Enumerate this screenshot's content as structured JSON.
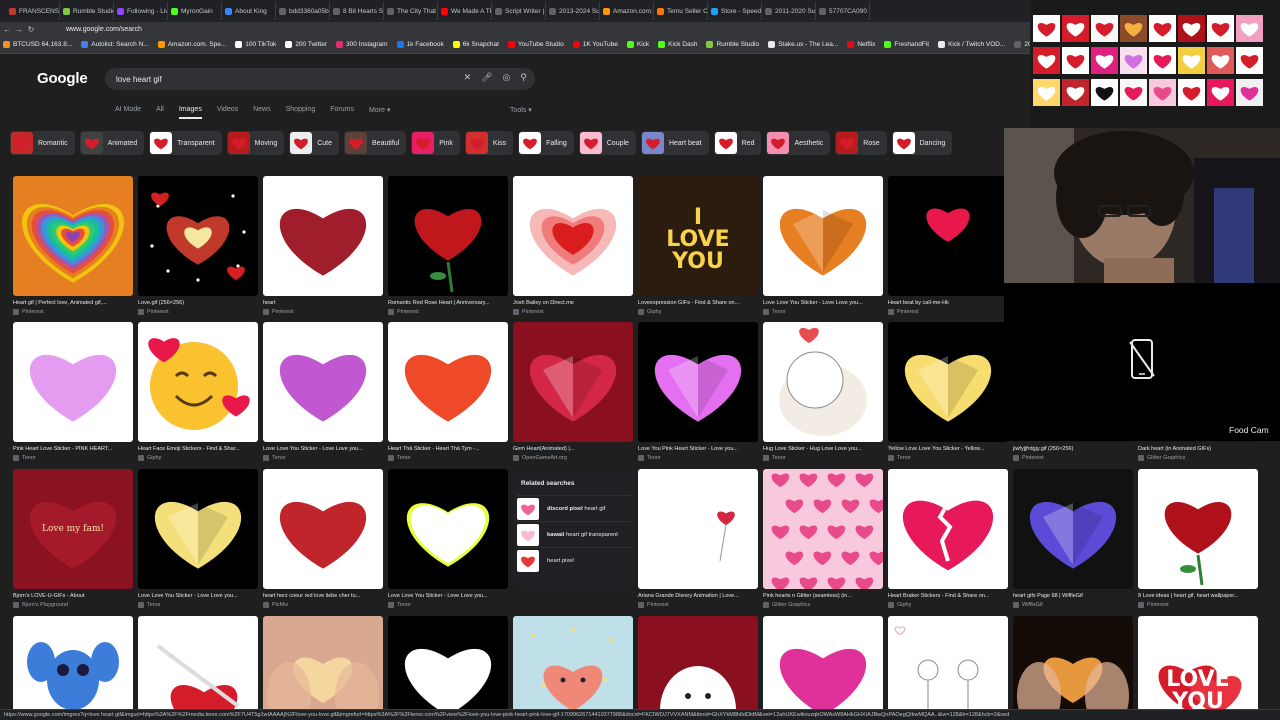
{
  "browser": {
    "tabs": [
      {
        "label": "FRANSCENSIO",
        "color": "#c0392b"
      },
      {
        "label": "Rumble Studio",
        "color": "#85c742"
      },
      {
        "label": "Following - Liv",
        "color": "#9146ff"
      },
      {
        "label": "MyronGain",
        "color": "#53fc18"
      },
      {
        "label": "About King",
        "color": "#3b82f6"
      },
      {
        "label": "bdd3360a05b",
        "color": "#5f6368"
      },
      {
        "label": "8 Bit Hearts St",
        "color": "#5f6368"
      },
      {
        "label": "The City That I",
        "color": "#5f6368"
      },
      {
        "label": "We Made A TF",
        "color": "#ff0000"
      },
      {
        "label": "Script Writer |",
        "color": "#5f6368"
      },
      {
        "label": "2013-2024 Su",
        "color": "#5f6368"
      },
      {
        "label": "Amazon.com: A",
        "color": "#ff9900"
      },
      {
        "label": "Temu Seller C",
        "color": "#fb7701"
      },
      {
        "label": "Store - Speedi",
        "color": "#1da1f2"
      },
      {
        "label": "2011-2020 Su",
        "color": "#5f6368"
      },
      {
        "label": "57707CA090",
        "color": "#5f6368"
      }
    ],
    "url": "www.google.com/search",
    "bookmarks": [
      {
        "label": "BTCUSD 64,163.8...",
        "color": "#f7931a"
      },
      {
        "label": "Autolist: Search N...",
        "color": "#3b82f6"
      },
      {
        "label": "Amazon.com. Spe...",
        "color": "#ff9900"
      },
      {
        "label": "100 TikTok",
        "color": "#ffffff"
      },
      {
        "label": "200 Twitter",
        "color": "#ffffff"
      },
      {
        "label": "300 Instagram",
        "color": "#e1306c"
      },
      {
        "label": "1k Facebook",
        "color": "#1877f2"
      },
      {
        "label": "6k Snapchat",
        "color": "#fffc00"
      },
      {
        "label": "YouTube Studio",
        "color": "#ff0000"
      },
      {
        "label": "1K YouTube",
        "color": "#ff0000"
      },
      {
        "label": "Kick",
        "color": "#53fc18"
      },
      {
        "label": "Kick Dash",
        "color": "#53fc18"
      },
      {
        "label": "Rumble Studio",
        "color": "#85c742"
      },
      {
        "label": "Stake.us - The Lea...",
        "color": "#e8eaed"
      },
      {
        "label": "Netflix",
        "color": "#e50914"
      },
      {
        "label": "FreshandFit",
        "color": "#53fc18"
      },
      {
        "label": "Kick / Twitch VOD...",
        "color": "#e8eaed"
      },
      {
        "label": "2013-",
        "color": "#5f6368"
      }
    ]
  },
  "google": {
    "logo": "Google",
    "query": "love heart gif",
    "tabs": [
      "AI Mode",
      "All",
      "Images",
      "Videos",
      "News",
      "Shopping",
      "Forums",
      "More ▾"
    ],
    "active_tab": "Images",
    "tools": "Tools ▾",
    "chips": [
      {
        "label": "Romantic",
        "color": "#c62828"
      },
      {
        "label": "Animated",
        "color": "#424242"
      },
      {
        "label": "Transparent",
        "color": "#ffffff"
      },
      {
        "label": "Moving",
        "color": "#b71c1c"
      },
      {
        "label": "Cute",
        "color": "#eeeeee"
      },
      {
        "label": "Beautiful",
        "color": "#5d4037"
      },
      {
        "label": "Pink",
        "color": "#e91e63"
      },
      {
        "label": "Kiss",
        "color": "#d32f2f"
      },
      {
        "label": "Falling",
        "color": "#ffffff"
      },
      {
        "label": "Couple",
        "color": "#f8bbd0"
      },
      {
        "label": "Heart beat",
        "color": "#7986cb"
      },
      {
        "label": "Red",
        "color": "#ffffff"
      },
      {
        "label": "Aesthetic",
        "color": "#f48fb1"
      },
      {
        "label": "Rose",
        "color": "#b71c1c"
      },
      {
        "label": "Dancing",
        "color": "#ffffff"
      }
    ],
    "results": [
      {
        "caption": "Heart gif | Perfect love, Animated gif,...",
        "source": "Pinterest",
        "bg": "#e67e22",
        "heart": "#9b59b6",
        "style": "rainbow"
      },
      {
        "caption": "Love.gif (256×256)",
        "source": "Pinterest",
        "bg": "#000000",
        "heart": "#c0392b",
        "style": "sparkle"
      },
      {
        "caption": "heart",
        "source": "Pinterest",
        "bg": "#ffffff",
        "heart": "#a01d2b",
        "style": "glitter"
      },
      {
        "caption": "Romantic Red Rose Heart | Anniversary...",
        "source": "Pinterest",
        "bg": "#000000",
        "heart": "#c0171c",
        "style": "rose"
      },
      {
        "caption": "Josh Bailey on Direct.me",
        "source": "Pinterest",
        "bg": "#ffffff",
        "heart": "#e84c4c",
        "style": "layered"
      },
      {
        "caption": "Loveexpression GIFs - Find & Share on...",
        "source": "Giphy",
        "bg": "#2b1c0e",
        "heart": "#f1c40f",
        "style": "iloveyou"
      },
      {
        "caption": "Love Love You Sticker - Love Love you...",
        "source": "Tenor",
        "bg": "#ffffff",
        "heart": "#e67e22",
        "style": "gem"
      },
      {
        "caption": "Heart beat by call-me-Hk",
        "source": "Pinterest",
        "bg": "#000000",
        "heart": "#e8194a",
        "style": "pixelsmall"
      },
      {
        "caption": "Pink Heart Love Sticker - PINK HEART...",
        "source": "Tenor",
        "bg": "#ffffff",
        "heart": "#e49cf0",
        "style": "pixel"
      },
      {
        "caption": "Heart Face Emoji Stickers - Find & Shar...",
        "source": "Giphy",
        "bg": "#ffffff",
        "heart": "#f9c22e",
        "style": "emoji"
      },
      {
        "caption": "Love Love You Sticker - Love Love you...",
        "source": "Tenor",
        "bg": "#ffffff",
        "heart": "#c158d1",
        "style": "pixel"
      },
      {
        "caption": "Heart Thả Sticker - Heart Thả Tym -...",
        "source": "Tenor",
        "bg": "#ffffff",
        "heart": "#ee4a2a",
        "style": "plain"
      },
      {
        "caption": "Gem Heart(Animated) |...",
        "source": "OpenGameArt.org",
        "bg": "#8a0f1f",
        "heart": "#d42745",
        "style": "gem"
      },
      {
        "caption": "Love You Pink Heart Sticker - Love you...",
        "source": "Tenor",
        "bg": "#000000",
        "heart": "#e46ff0",
        "style": "gem"
      },
      {
        "caption": "Hug Love Sticker - Hug Love Love you...",
        "source": "Tenor",
        "bg": "#ffffff",
        "heart": "#ffffff",
        "style": "bear"
      },
      {
        "caption": "Yellow Love Love You Sticker - Yellow...",
        "source": "Tenor",
        "bg": "#000000",
        "heart": "#f7dc6f",
        "style": "gem"
      },
      {
        "caption": "jiwfyjjfrdgjy.gif (256×256)",
        "source": "Pinterest",
        "bg": "#1a1a1a",
        "heart": "#1a1a1a",
        "style": "none"
      },
      {
        "caption": "Dark heart (in Animated GIFs)",
        "source": "Glitter Graphics",
        "bg": "#1a1a1a",
        "heart": "#1a1a1a",
        "style": "none"
      },
      {
        "caption": "Bjorn's LOVE-U-GIFs - About",
        "source": "Bjorn's Playground",
        "bg": "#8b1221",
        "heart": "#a41a2b",
        "style": "lovemyfam"
      },
      {
        "caption": "Love Love You Sticker - Love Love you...",
        "source": "Tenor",
        "bg": "#000000",
        "heart": "#f4e07a",
        "style": "gem"
      },
      {
        "caption": "heart herz coeur red love liebe cher tu...",
        "source": "PicMix",
        "bg": "#ffffff",
        "heart": "#c0252b",
        "style": "plain"
      },
      {
        "caption": "Love Love You Sticker - Love Love you...",
        "source": "Tenor",
        "bg": "#000000",
        "heart": "#ffffff",
        "style": "neon"
      },
      {
        "caption": "Ariana Grande Disney Animation | Love...",
        "source": "Pinterest",
        "bg": "#ffffff",
        "heart": "#d42745",
        "style": "balloon"
      },
      {
        "caption": "Pink hearts n Glitter (seamless) (in...",
        "source": "Glitter Graphics",
        "bg": "#f8c8dc",
        "heart": "#e84b8a",
        "style": "pattern"
      },
      {
        "caption": "Heart Braker Stickers - Find & Share on...",
        "source": "Giphy",
        "bg": "#ffffff",
        "heart": "#e8195a",
        "style": "broken"
      },
      {
        "caption": "heart gifs Page 98 | WiffleGif",
        "source": "WiffleGif",
        "bg": "#111111",
        "heart": "#5b4bd6",
        "style": "gem"
      },
      {
        "caption": "8 Love ideas | heart gif, heart wallpaper...",
        "source": "Pinterest",
        "bg": "#ffffff",
        "heart": "#b0121b",
        "style": "rose"
      },
      {
        "caption": "",
        "source": "",
        "bg": "#ffffff",
        "heart": "#3b82f6",
        "style": "stitch"
      },
      {
        "caption": "",
        "source": "",
        "bg": "#ffffff",
        "heart": "#d41c2b",
        "style": "arrow"
      },
      {
        "caption": "",
        "source": "",
        "bg": "#d9a890",
        "heart": "#f8d8a0",
        "style": "hands"
      },
      {
        "caption": "",
        "source": "",
        "bg": "#000000",
        "heart": "#ffffff",
        "style": "plain"
      },
      {
        "caption": "",
        "source": "",
        "bg": "#bfe0e8",
        "heart": "#f08878",
        "style": "cute"
      },
      {
        "caption": "",
        "source": "",
        "bg": "#8a0f1f",
        "heart": "#ffffff",
        "style": "ghost"
      },
      {
        "caption": "",
        "source": "",
        "bg": "#ffffff",
        "heart": "#e0309a",
        "style": "glitter"
      },
      {
        "caption": "",
        "source": "",
        "bg": "#ffffff",
        "heart": "#888888",
        "style": "sketch"
      },
      {
        "caption": "",
        "source": "",
        "bg": "#150c08",
        "heart": "#f0a040",
        "style": "hands"
      },
      {
        "caption": "",
        "source": "",
        "bg": "#ffffff",
        "heart": "#d41c2b",
        "style": "iloveyou2"
      }
    ],
    "related": {
      "title": "Related searches",
      "items": [
        {
          "bold": "discord pixel",
          "rest": " heart gif",
          "color": "#f06292"
        },
        {
          "bold": "kawaii",
          "rest": " heart gif transparent",
          "color": "#f8bbd0"
        },
        {
          "bold": "",
          "rest": "heart pixel",
          "color": "#e53935"
        }
      ]
    }
  },
  "overlay": {
    "cam_label": "Food Cam"
  },
  "statusbar": "https://www.google.com/imgres?q=love heart gif&imgurl=https%3A%2F%2Fmedia.tenor.com%2F7U4T5g1wIAAAAj%2Flove-you-love.gif&imgrefurl=https%3A%2F%2Ftenor.com%2Fview%2Flove-you-love-pink-heart-pink-love-gif-17099626714410377988&docid=FKCIWOJ7VVXANM&tbnid=GhXYkM8h6dDldM&vet=12ahUKEwikvuzqbOWAxW8AHkGHXIAJBwQnPAOegQIkwMQAA..i&w=128&h=128&hcb=2&ved"
}
